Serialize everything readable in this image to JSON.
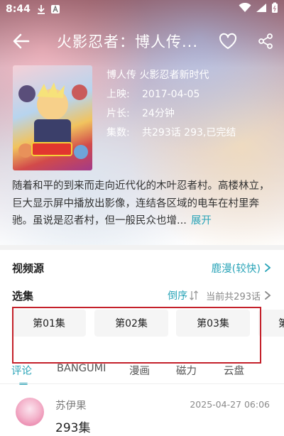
{
  "status_bar": {
    "time": "8:44"
  },
  "header": {
    "title": "火影忍者：博人传..."
  },
  "info": {
    "subtitle": "博人传 火影忍者新时代",
    "release_label": "上映:",
    "release_value": "2017-04-05",
    "duration_label": "片长:",
    "duration_value": "24分钟",
    "episodes_label": "集数:",
    "episodes_value": "共293话 293,已完结"
  },
  "description": {
    "text": "随着和平的到来而走向近代化的木叶忍者村。高楼林立，巨大显示屏中播放出影像，连结各区域的电车在村里奔驰。虽说是忍者村，但一般民众也增...",
    "expand_label": "展开"
  },
  "video_source": {
    "label": "视频源",
    "value": "鹿漫(较快)"
  },
  "episode_select": {
    "label": "选集",
    "order_label": "倒序",
    "count_info": "当前共293话",
    "episodes": [
      "第01集",
      "第02集",
      "第03集",
      "第"
    ]
  },
  "tabs": [
    "评论",
    "BANGUMI",
    "漫画",
    "磁力",
    "云盘"
  ],
  "comment": {
    "user": "苏伊果",
    "time": "2025-04-27 06:06",
    "text": "293集"
  },
  "colors": {
    "accent": "#2aa4b8",
    "highlight_box": "#c4202a"
  }
}
